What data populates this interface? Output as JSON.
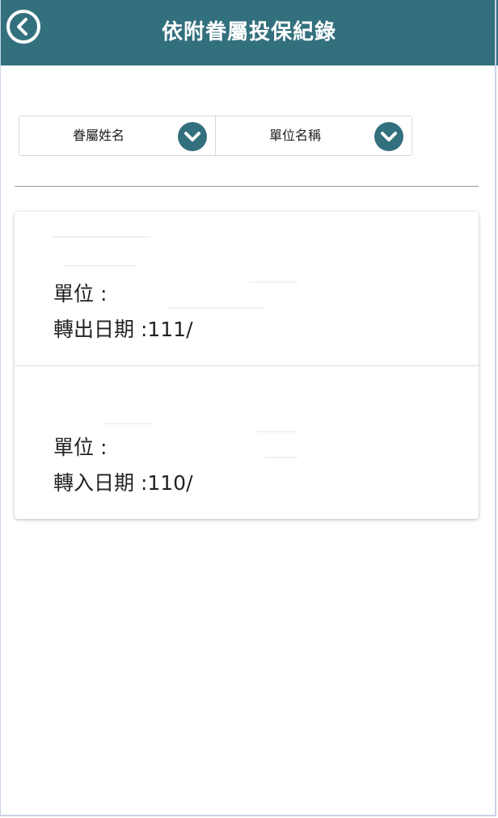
{
  "header": {
    "title": "依附眷屬投保紀錄",
    "back_icon": "chevron-left-circle-icon"
  },
  "filters": [
    {
      "label": "眷屬姓名",
      "icon": "chevron-down-circle-icon"
    },
    {
      "label": "單位名稱",
      "icon": "chevron-down-circle-icon"
    }
  ],
  "records": [
    {
      "unit_label": "單位 :",
      "date_label": "轉出日期 :111/"
    },
    {
      "unit_label": "單位 :",
      "date_label": "轉入日期 :110/"
    }
  ],
  "colors": {
    "header_bg": "#33707e",
    "accent": "#33707e"
  }
}
